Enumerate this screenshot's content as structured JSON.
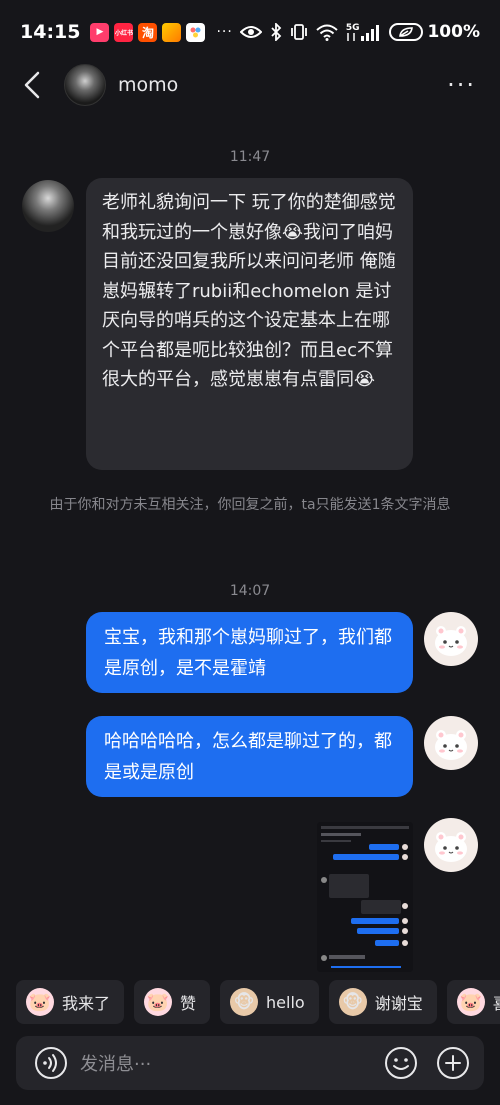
{
  "status_bar": {
    "time": "14:15",
    "apps": [
      {
        "name": "video-app-icon",
        "label": "▶",
        "color": "#ff3d6c"
      },
      {
        "name": "jd-app-icon",
        "label": "小红书",
        "color": "#ff2442"
      },
      {
        "name": "taobao-app-icon",
        "label": "淘",
        "color": "#ff5000"
      },
      {
        "name": "xianyu-app-icon",
        "label": "",
        "color": "#ffcc00"
      },
      {
        "name": "gallery-app-icon",
        "label": "",
        "color": "#ffffff"
      }
    ],
    "more": "···",
    "network_label": "5G",
    "battery_percent": "100%"
  },
  "nav": {
    "title": "momo",
    "more": "···"
  },
  "chat": {
    "timestamp_1": "11:47",
    "incoming_message": "老师礼貌询问一下 玩了你的楚御感觉和我玩过的一个崽好像😭我问了咱妈目前还没回复我所以来问问老师 俺随崽妈辗转了rubii和echomelon 是讨厌向导的哨兵的这个设定基本上在哪个平台都是呃比较独创？而且ec不算很大的平台，感觉崽崽有点雷同😭",
    "system_notice": "由于你和对方未互相关注，你回复之前，ta只能发送1条文字消息",
    "timestamp_2": "14:07",
    "outgoing_1": "宝宝，我和那个崽妈聊过了，我们都是原创，是不是霍靖",
    "outgoing_2": "哈哈哈哈哈，怎么都是聊过了的，都是或是原创"
  },
  "quick_replies": [
    {
      "label": "我来了",
      "emoji": "🐷"
    },
    {
      "label": "赞",
      "emoji": "🐷"
    },
    {
      "label": "hello",
      "emoji": "🐵"
    },
    {
      "label": "谢谢宝",
      "emoji": "🐵"
    },
    {
      "label": "喜",
      "emoji": "🐷"
    }
  ],
  "input": {
    "placeholder": "发消息···"
  }
}
